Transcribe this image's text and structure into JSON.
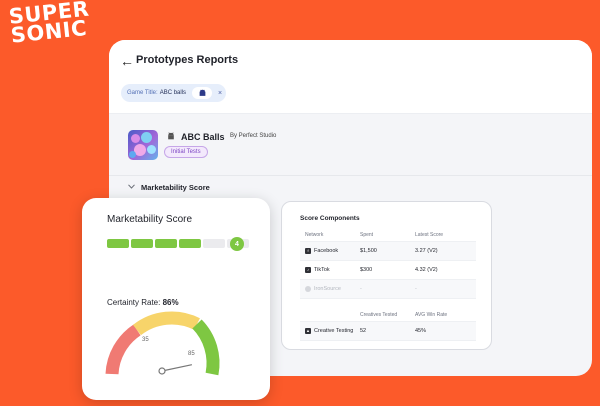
{
  "brand": {
    "line1": "SUPER",
    "line2": "SONIC"
  },
  "header": {
    "title": "Prototypes Reports"
  },
  "filter_chip": {
    "label": "Game Title:",
    "value": "ABC balls",
    "close": "×"
  },
  "game": {
    "name": "ABC Balls",
    "studio": "By Perfect Studio",
    "stage": "Initial Tests"
  },
  "section": {
    "label": "Marketability Score"
  },
  "marketability_card": {
    "title": "Marketability Score",
    "score": "4",
    "score_value": 4,
    "segments_total": 6,
    "certainty_label": "Certainty Rate:",
    "certainty_value": "86%",
    "gauge": {
      "low_mark": "35",
      "high_mark": "85",
      "needle_value": 86,
      "min": 0,
      "max": 100
    }
  },
  "score_components": {
    "title": "Score Components",
    "columns": [
      "Network",
      "Spent",
      "Latest Score"
    ],
    "rows": [
      {
        "network": "Facebook",
        "spent": "$1,500",
        "score": "3.27 (V2)",
        "icon": "facebook-icon"
      },
      {
        "network": "TikTok",
        "spent": "$300",
        "score": "4.32 (V2)",
        "icon": "tiktok-icon"
      },
      {
        "network": "IronSource",
        "spent": "-",
        "score": "-",
        "icon": "ironsource-icon"
      }
    ],
    "columns2": [
      "",
      "Creatives Tested",
      "AVG Win Rate"
    ],
    "rows2": [
      {
        "name": "Creative Testing",
        "tested": "52",
        "rate": "45%",
        "icon": "creative-testing-icon"
      }
    ]
  },
  "colors": {
    "background": "#fc5a2a",
    "green": "#7ec742",
    "yellow": "#f7d46a",
    "red": "#f07a73",
    "chip": "#e6eefb"
  }
}
